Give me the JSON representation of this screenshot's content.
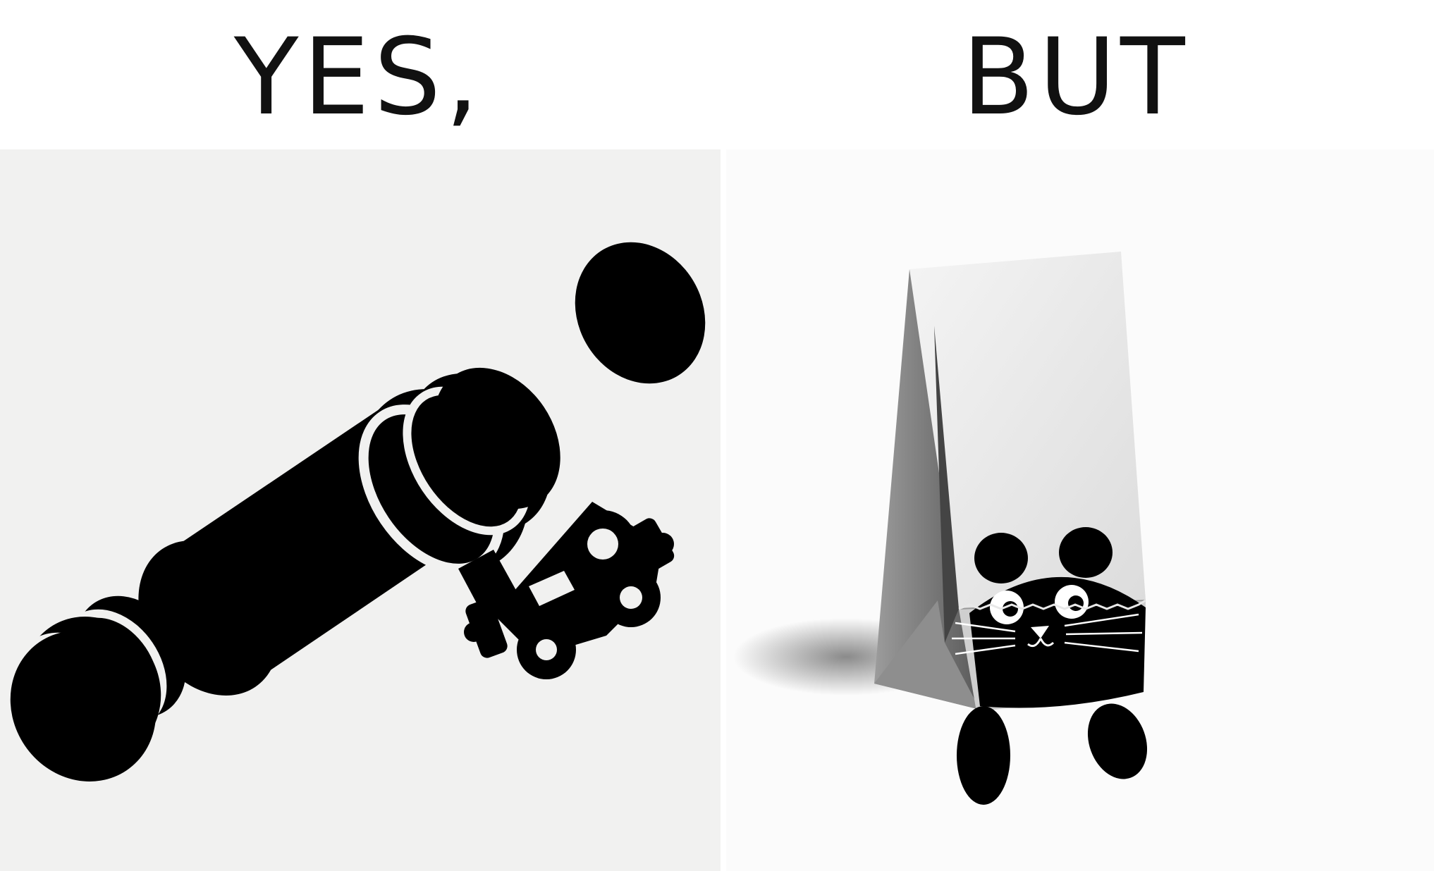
{
  "captions": {
    "left": "YES,",
    "right": "BUT"
  },
  "panels": {
    "left": {
      "icons": [
        "telescope-icon",
        "lens-cap-icon",
        "toy-car-icon"
      ],
      "background_color": "#f1f1f0"
    },
    "right": {
      "icons": [
        "paper-bag-icon",
        "cat-icon"
      ],
      "background_color": "#fbfbfb"
    }
  },
  "colors": {
    "ink": "#111111",
    "paper": "#ffffff"
  }
}
